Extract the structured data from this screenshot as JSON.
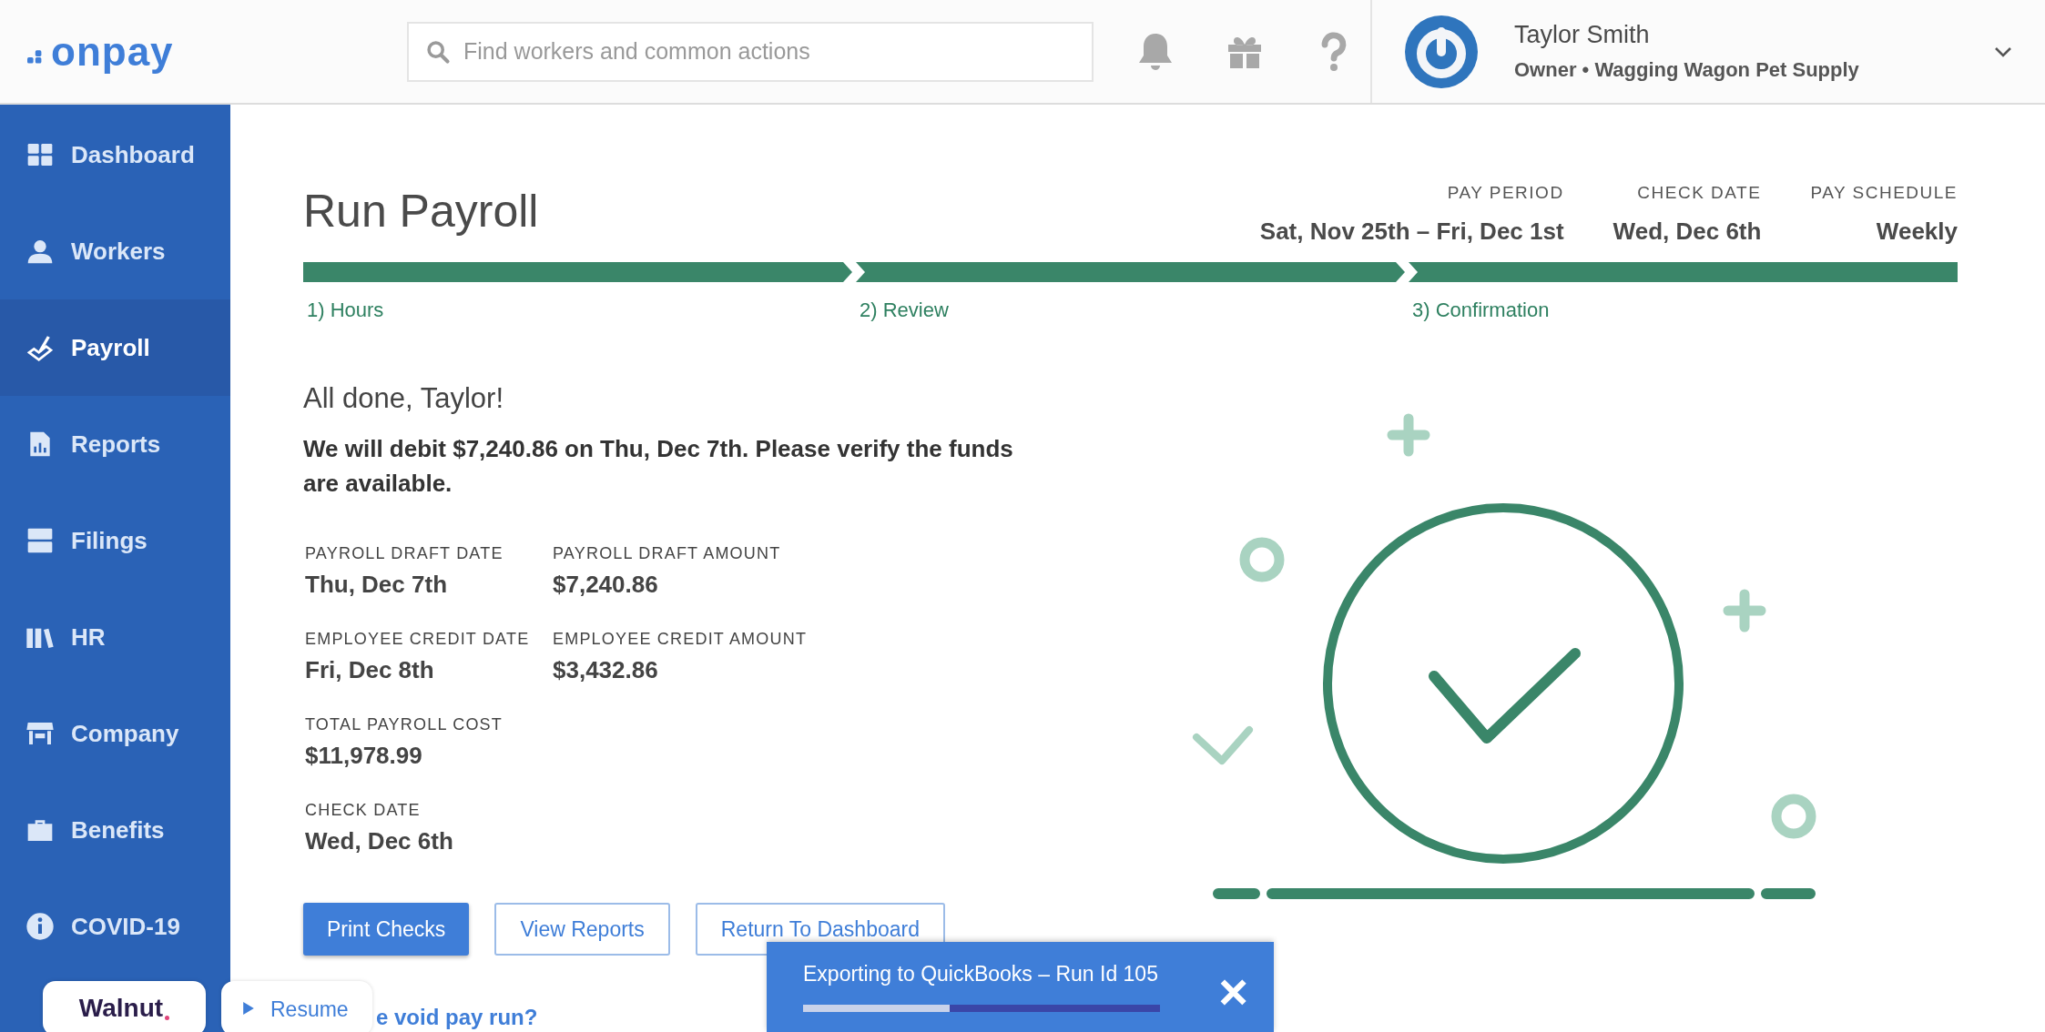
{
  "header": {
    "logo": "onpay",
    "search": {
      "placeholder": "Find workers and common actions"
    },
    "user": {
      "name": "Taylor Smith",
      "role": "Owner • Wagging Wagon Pet Supply"
    }
  },
  "sidebar": {
    "items": [
      {
        "label": "Dashboard",
        "kind": "dashboard",
        "selected": false
      },
      {
        "label": "Workers",
        "kind": "workers",
        "selected": false
      },
      {
        "label": "Payroll",
        "kind": "payroll",
        "selected": true
      },
      {
        "label": "Reports",
        "kind": "reports",
        "selected": false
      },
      {
        "label": "Filings",
        "kind": "filings",
        "selected": false
      },
      {
        "label": "HR",
        "kind": "hr",
        "selected": false
      },
      {
        "label": "Company",
        "kind": "company",
        "selected": false
      },
      {
        "label": "Benefits",
        "kind": "benefits",
        "selected": false
      },
      {
        "label": "COVID-19",
        "kind": "info",
        "selected": false
      }
    ]
  },
  "page": {
    "title": "Run Payroll",
    "summary": [
      {
        "label": "PAY PERIOD",
        "value": "Sat, Nov 25th – Fri, Dec 1st"
      },
      {
        "label": "CHECK DATE",
        "value": "Wed, Dec 6th"
      },
      {
        "label": "PAY SCHEDULE",
        "value": "Weekly"
      }
    ],
    "steps": [
      {
        "label": "1) Hours",
        "done": true
      },
      {
        "label": "2) Review",
        "done": true
      },
      {
        "label": "3) Confirmation",
        "done": true
      }
    ],
    "heading": "All done, Taylor!",
    "message": "We will debit $7,240.86 on Thu, Dec 7th. Please verify the funds are available.",
    "details": [
      [
        {
          "label": "PAYROLL DRAFT DATE",
          "value": "Thu, Dec 7th"
        },
        {
          "label": "PAYROLL DRAFT AMOUNT",
          "value": "$7,240.86"
        }
      ],
      [
        {
          "label": "EMPLOYEE CREDIT DATE",
          "value": "Fri, Dec 8th"
        },
        {
          "label": "EMPLOYEE CREDIT AMOUNT",
          "value": "$3,432.86"
        }
      ],
      [
        {
          "label": "TOTAL PAYROLL COST",
          "value": "$11,978.99"
        }
      ],
      [
        {
          "label": "CHECK DATE",
          "value": "Wed, Dec 6th"
        }
      ]
    ],
    "buttons": [
      {
        "label": "Print Checks",
        "kind": "primary"
      },
      {
        "label": "View Reports",
        "kind": "outline"
      },
      {
        "label": "Return To Dashboard",
        "kind": "outline"
      }
    ],
    "link": "e void pay run?"
  },
  "toast": {
    "text": "Exporting to QuickBooks – Run Id 105",
    "close": "×",
    "level": 0.41
  },
  "walnut": {
    "logo": "Walnut",
    "resume": "Resume"
  }
}
